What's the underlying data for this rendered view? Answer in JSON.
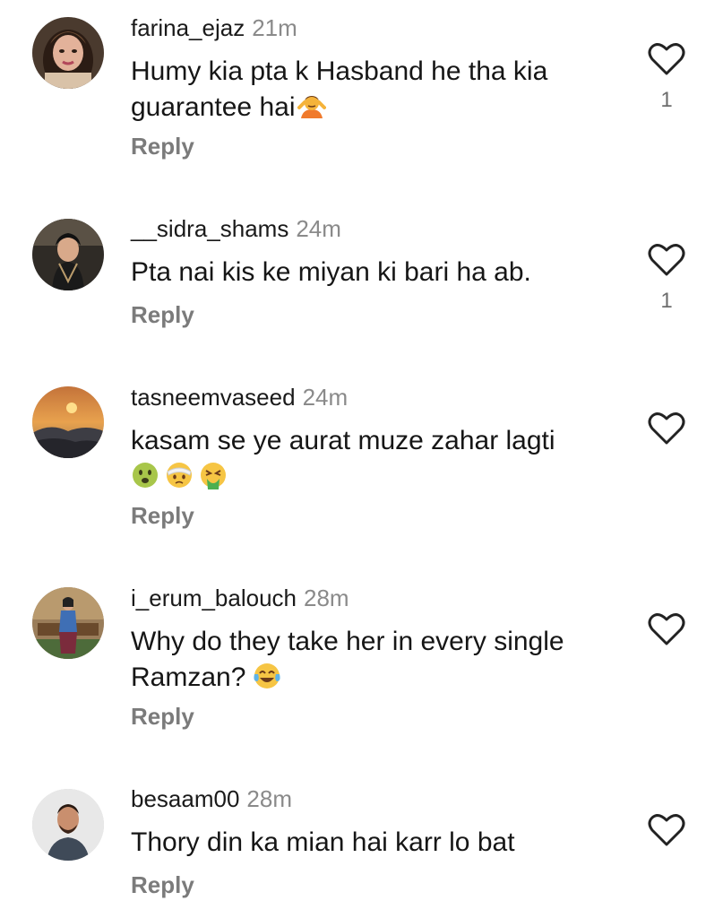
{
  "comments": [
    {
      "username": "farina_ejaz",
      "time": "21m",
      "text": "Humy kia pta k Hasband he tha kia guarantee hai",
      "emojis": [
        "person-shrugging"
      ],
      "reply": "Reply",
      "likes": "1",
      "avatar": "woman-selfie"
    },
    {
      "username": "__sidra_shams",
      "time": "24m",
      "text": "Pta nai kis ke miyan ki bari ha ab.",
      "emojis": [],
      "reply": "Reply",
      "likes": "1",
      "avatar": "woman-dark-portrait"
    },
    {
      "username": "tasneemvaseed",
      "time": "24m",
      "text": "kasam se ye aurat muze zahar lagti",
      "emojis": [
        "nauseated-face",
        "face-with-head-bandage",
        "face-vomiting"
      ],
      "reply": "Reply",
      "likes": "",
      "avatar": "mountain-sunset"
    },
    {
      "username": "i_erum_balouch",
      "time": "28m",
      "text": "Why do they take her in every single Ramzan?",
      "emojis": [
        "face-with-tears-of-joy"
      ],
      "reply": "Reply",
      "likes": "",
      "avatar": "woman-full-body"
    },
    {
      "username": "besaam00",
      "time": "28m",
      "text": "Thory din ka mian hai karr lo bat",
      "emojis": [],
      "reply": "Reply",
      "likes": "",
      "avatar": "man-portrait"
    }
  ],
  "colors": {
    "username": "#1a1a1a",
    "secondary_text": "#8a8a8a",
    "reply": "#7b7b7b",
    "heart_outline": "#222222"
  }
}
